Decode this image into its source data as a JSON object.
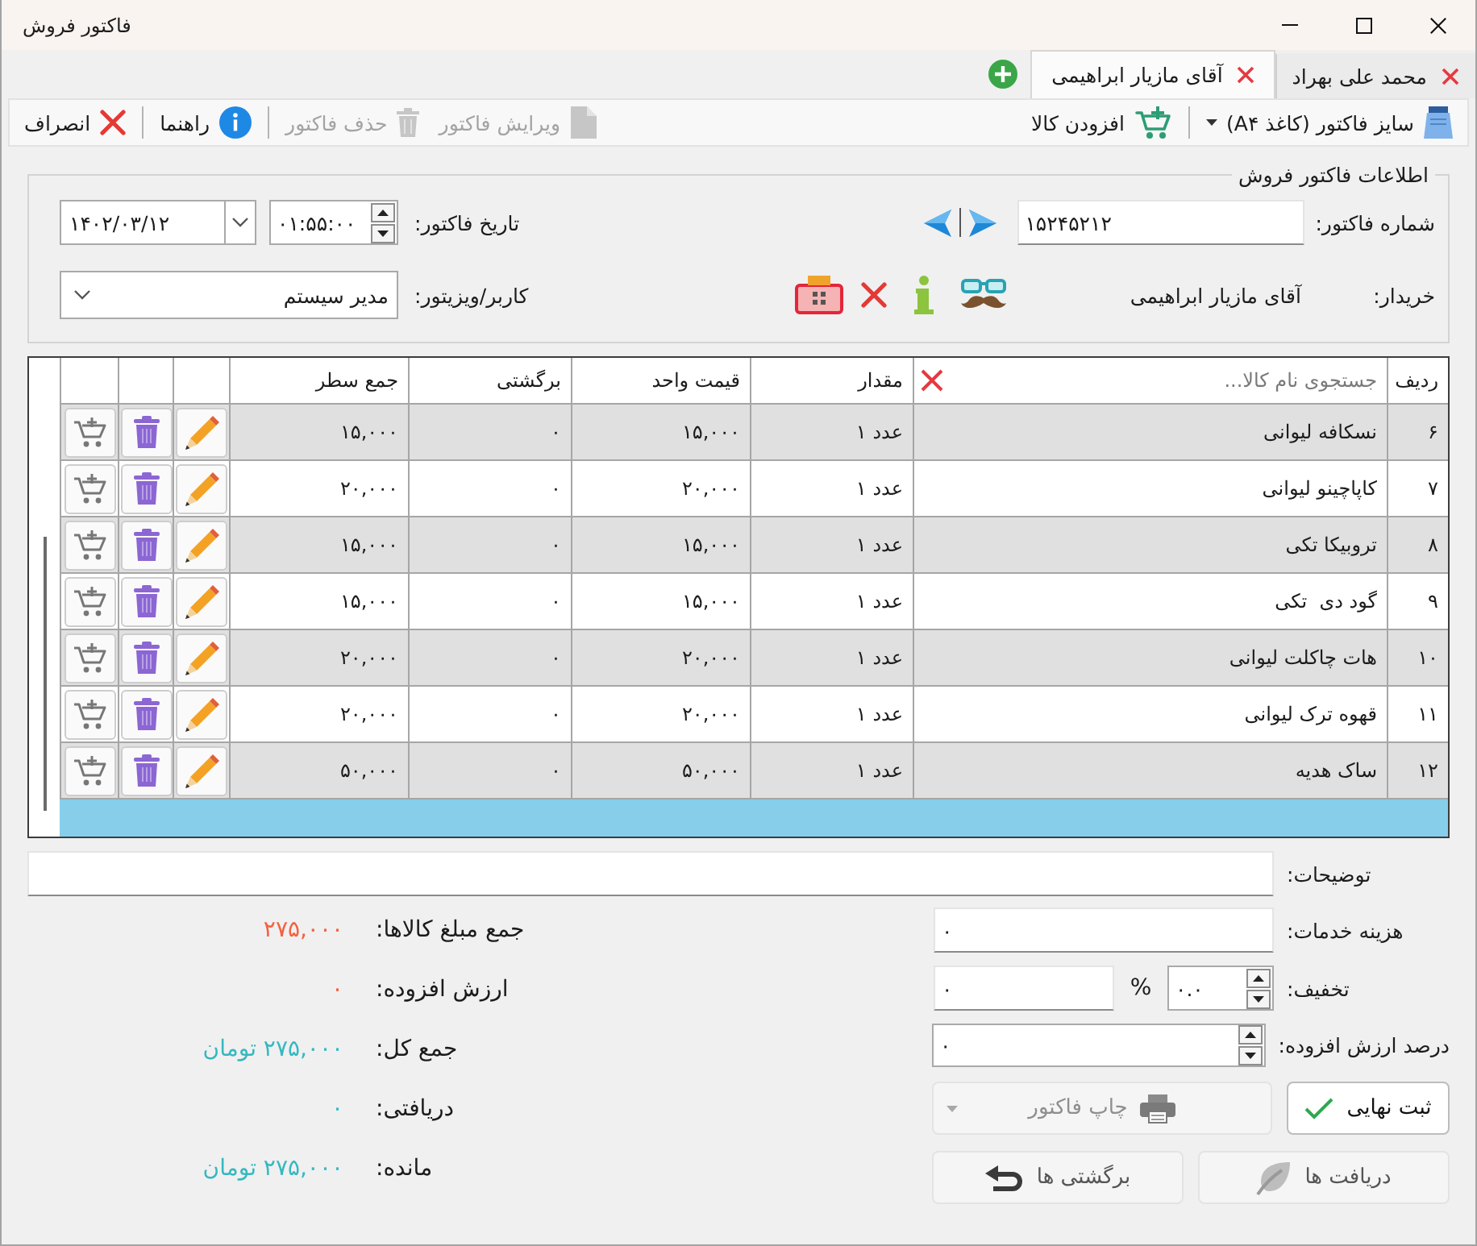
{
  "window": {
    "title": "فاکتور فروش"
  },
  "tabs": [
    {
      "label": "محمد علی بهراد",
      "selected": false
    },
    {
      "label": "آقای مازیار ابراهیمی",
      "selected": true
    }
  ],
  "toolbar": {
    "paper_size": {
      "label": "سایز فاکتور (کاغذ A۴)",
      "disabled": false
    },
    "add_item": {
      "label": "افزودن کالا",
      "disabled": false
    },
    "edit_invoice": {
      "label": "ویرایش فاکتور",
      "disabled": true
    },
    "delete_invoice": {
      "label": "حذف فاکتور",
      "disabled": true
    },
    "help": {
      "label": "راهنما",
      "disabled": false
    },
    "cancel": {
      "label": "انصراف",
      "disabled": false
    }
  },
  "invoice_info": {
    "title": "اطلاعات فاکتور فروش",
    "invoice_number": {
      "label": "شماره فاکتور:",
      "value": "۱۵۲۴۵۲۱۲"
    },
    "invoice_date": {
      "label": "تاریخ فاکتور:",
      "time": "۰۱:۵۵:۰۰",
      "date": "۱۴۰۲/۰۳/۱۲"
    },
    "buyer": {
      "label": "خریدار:",
      "value": "آقای مازیار ابراهیمی"
    },
    "user": {
      "label": "کاربر/ویزیتور:",
      "value": "مدیر سیستم"
    }
  },
  "table": {
    "columns": [
      {
        "kind": "header",
        "label": "ردیف"
      },
      {
        "kind": "search",
        "placeholder": "جستجوی نام کالا..."
      },
      {
        "kind": "header",
        "label": "مقدار"
      },
      {
        "kind": "header",
        "label": "قیمت واحد"
      },
      {
        "kind": "header",
        "label": "برگشتی"
      },
      {
        "kind": "header",
        "label": "جمع سطر"
      }
    ],
    "rows": [
      {
        "row": "۶",
        "name": "نسکافه لیوانی",
        "quantity": "۱ عدد",
        "unit_price": "۱۵,۰۰۰",
        "returned": "۰",
        "line_total": "۱۵,۰۰۰"
      },
      {
        "row": "۷",
        "name": "کاپاچینو لیوانی",
        "quantity": "۱ عدد",
        "unit_price": "۲۰,۰۰۰",
        "returned": "۰",
        "line_total": "۲۰,۰۰۰"
      },
      {
        "row": "۸",
        "name": "تروبیکا تکی",
        "quantity": "۱ عدد",
        "unit_price": "۱۵,۰۰۰",
        "returned": "۰",
        "line_total": "۱۵,۰۰۰"
      },
      {
        "row": "۹",
        "name": "گود دی  تکی",
        "quantity": "۱ عدد",
        "unit_price": "۱۵,۰۰۰",
        "returned": "۰",
        "line_total": "۱۵,۰۰۰"
      },
      {
        "row": "۱۰",
        "name": "هات چاکلت لیوانی",
        "quantity": "۱ عدد",
        "unit_price": "۲۰,۰۰۰",
        "returned": "۰",
        "line_total": "۲۰,۰۰۰"
      },
      {
        "row": "۱۱",
        "name": "قهوه ترک لیوانی",
        "quantity": "۱ عدد",
        "unit_price": "۲۰,۰۰۰",
        "returned": "۰",
        "line_total": "۲۰,۰۰۰"
      },
      {
        "row": "۱۲",
        "name": "ساک هدیه",
        "quantity": "۱ عدد",
        "unit_price": "۵۰,۰۰۰",
        "returned": "۰",
        "line_total": "۵۰,۰۰۰"
      }
    ]
  },
  "notes": {
    "label": "توضیحات:"
  },
  "service_cost": {
    "label": "هزینه خدمات:",
    "value": "۰"
  },
  "discount": {
    "label": "تخفیف:",
    "percent": "۰.۰",
    "percent_sign": "%",
    "amount": "۰"
  },
  "vat_percent": {
    "label": "درصد ارزش افزوده:",
    "value": "۰"
  },
  "actions": [
    {
      "kind": "raised",
      "label": "ثبت نهایی",
      "disabled": false
    },
    {
      "kind": "split",
      "label": "چاپ فاکتور",
      "disabled": true
    },
    {
      "kind": "flat",
      "label": "دریافت ها",
      "disabled": false
    },
    {
      "kind": "flat",
      "label": "برگشتی ها",
      "disabled": false
    }
  ],
  "summary": [
    {
      "label": "جمع مبلغ کالاها:",
      "value": "۲۷۵,۰۰۰",
      "color": "#f4603f"
    },
    {
      "label": "ارزش افزوده:",
      "value": "۰",
      "color": "#f4603f"
    },
    {
      "label": "جمع کل:",
      "value": "۲۷۵,۰۰۰ تومان",
      "color": "#35b8c0"
    },
    {
      "label": "دریافتی:",
      "value": "۰",
      "color": "#35b8c0"
    },
    {
      "label": "مانده:",
      "value": "۲۷۵,۰۰۰ تومان",
      "color": "#35b8c0"
    }
  ]
}
